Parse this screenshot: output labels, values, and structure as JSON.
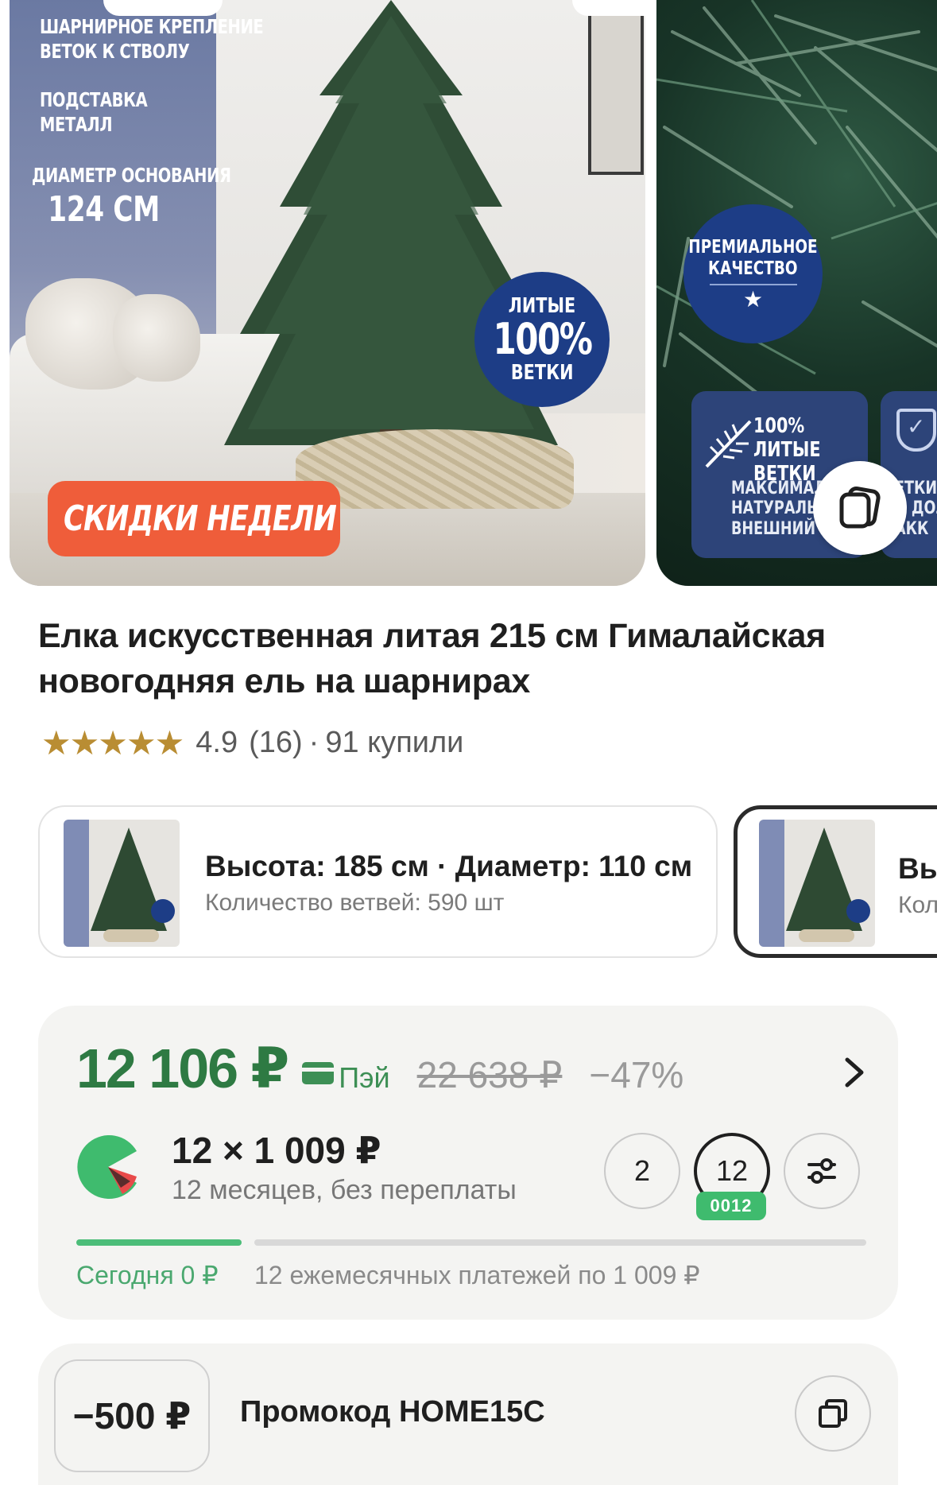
{
  "gallery": {
    "slide1": {
      "spec_lines": [
        "ШАРНИРНОЕ КРЕПЛЕНИЕ",
        "ВЕТОК К СТВОЛУ",
        "ПОДСТАВКА",
        "МЕТАЛЛ",
        "ДИАМЕТР ОСНОВАНИЯ",
        "124 СМ"
      ],
      "badge_top": "ЛИТЫЕ",
      "badge_mid": "100%",
      "badge_bottom": "ВЕТКИ",
      "promo_button": "СКИДКИ НЕДЕЛИ",
      "promo_chevron": "›"
    },
    "slide2": {
      "premium_line1": "ПРЕМИАЛЬНОЕ",
      "premium_line2": "КАЧЕСТВО",
      "premium_star": "★",
      "card1_title_line1": "100% ЛИТЫЕ",
      "card1_title_line2": "ВЕТКИ",
      "card1_text_line1": "МАКСИМАЛЬН",
      "card1_text_line2": "НАТУРАЛЬН",
      "card1_text_line3": "ВНЕШНИЙ ВИ",
      "card2_text_line1": "ЕТКИ",
      "card2_text_line2": "И ДОЛ",
      "card2_text_line3": "АКК"
    },
    "gallery_button_icon": "copy-stack-icon"
  },
  "product": {
    "title": "Елка искусственная литая 215 см Гималайская новогодняя ель на шарнирах",
    "stars": "★★★★★",
    "rating": "4.9",
    "reviews": "(16)",
    "separator": "·",
    "bought": "91 купили"
  },
  "variants": [
    {
      "line1": "Высота: 185 см · Диаметр: 110 см",
      "line2": "Количество ветвей: 590 шт",
      "selected": false
    },
    {
      "line1": "Вы",
      "line2": "Кол",
      "selected": true
    }
  ],
  "price": {
    "current": "12 106 ₽",
    "pay_label": "Пэй",
    "old": "22 638 ₽",
    "discount": "−47%",
    "chevron": "›",
    "split_main": "12 × 1 009 ₽",
    "split_sub": "12 месяцев, без переплаты",
    "terms": [
      "2",
      "12"
    ],
    "term_badge": "0012",
    "today_label": "Сегодня 0 ₽",
    "monthly_label": "12 ежемесячных платежей по 1 009 ₽",
    "selected_term": "12",
    "today_progress_fraction": 0.21
  },
  "promo": {
    "amount": "−500 ₽",
    "text": "Промокод HOME15C"
  },
  "colors": {
    "price_green": "#2e7a43",
    "badge_green": "#3fbb6e",
    "promo_orange": "#ef5d3a",
    "badge_blue": "#1d3d86",
    "star_gold": "#b98d33"
  }
}
